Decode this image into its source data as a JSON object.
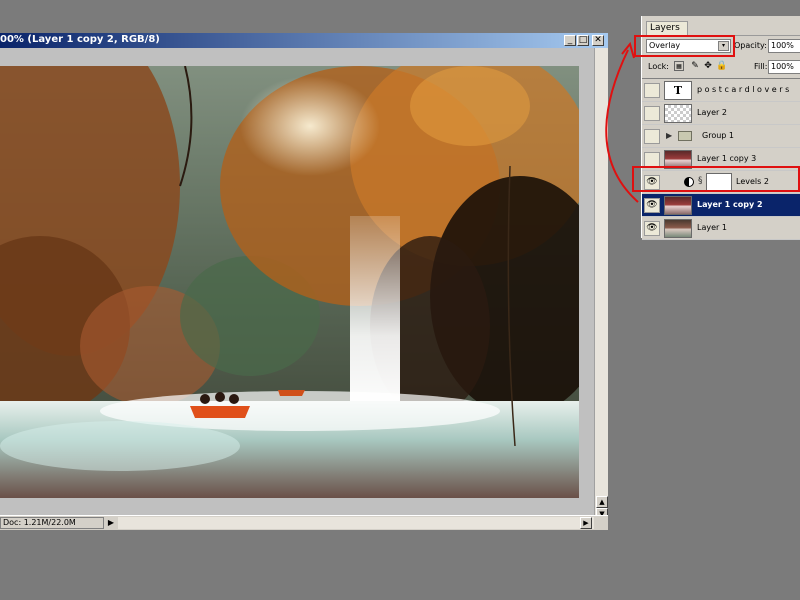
{
  "document": {
    "title": "00% (Layer 1 copy 2, RGB/8)",
    "status": "Doc: 1.21M/22.0M",
    "min_glyph": "_",
    "max_glyph": "□",
    "close_glyph": "✕",
    "status_arrow_glyph": "▶",
    "scroll_right_glyph": "▶",
    "scroll_up_glyph": "▲",
    "scroll_down_glyph": "▼"
  },
  "layers_panel": {
    "tab_label": "Layers",
    "tab_close_glyph": "✕",
    "blend_mode": "Overlay",
    "blend_arrow_glyph": "▾",
    "opacity_label": "Opacity:",
    "opacity_value": "100%",
    "lock_label": "Lock:",
    "lock_glyphs": {
      "pixels": "▦",
      "brush": "✎",
      "move": "✥",
      "all": "🔒"
    },
    "fill_label": "Fill:",
    "fill_value": "100%",
    "eye_glyph": "👁",
    "type_thumb_glyph": "T",
    "group_arrow_glyph": "▶",
    "chain_glyph": "§",
    "layers": [
      {
        "name": "p o s t c a r d l o v e r s",
        "type": "text",
        "visible": false,
        "selected": false
      },
      {
        "name": "Layer 2",
        "type": "transparent",
        "visible": false,
        "selected": false
      },
      {
        "name": "Group 1",
        "type": "group",
        "visible": false,
        "selected": false
      },
      {
        "name": "Layer 1 copy 3",
        "type": "photo-red",
        "visible": false,
        "selected": false
      },
      {
        "name": "Levels 2",
        "type": "adjustment",
        "visible": true,
        "selected": false
      },
      {
        "name": "Layer 1 copy 2",
        "type": "photo-red",
        "visible": true,
        "selected": true
      },
      {
        "name": "Layer 1",
        "type": "photo",
        "visible": true,
        "selected": false
      }
    ]
  },
  "colors": {
    "callout": "#e01010",
    "selection": "#0a246a",
    "background": "#7b7b7b"
  }
}
